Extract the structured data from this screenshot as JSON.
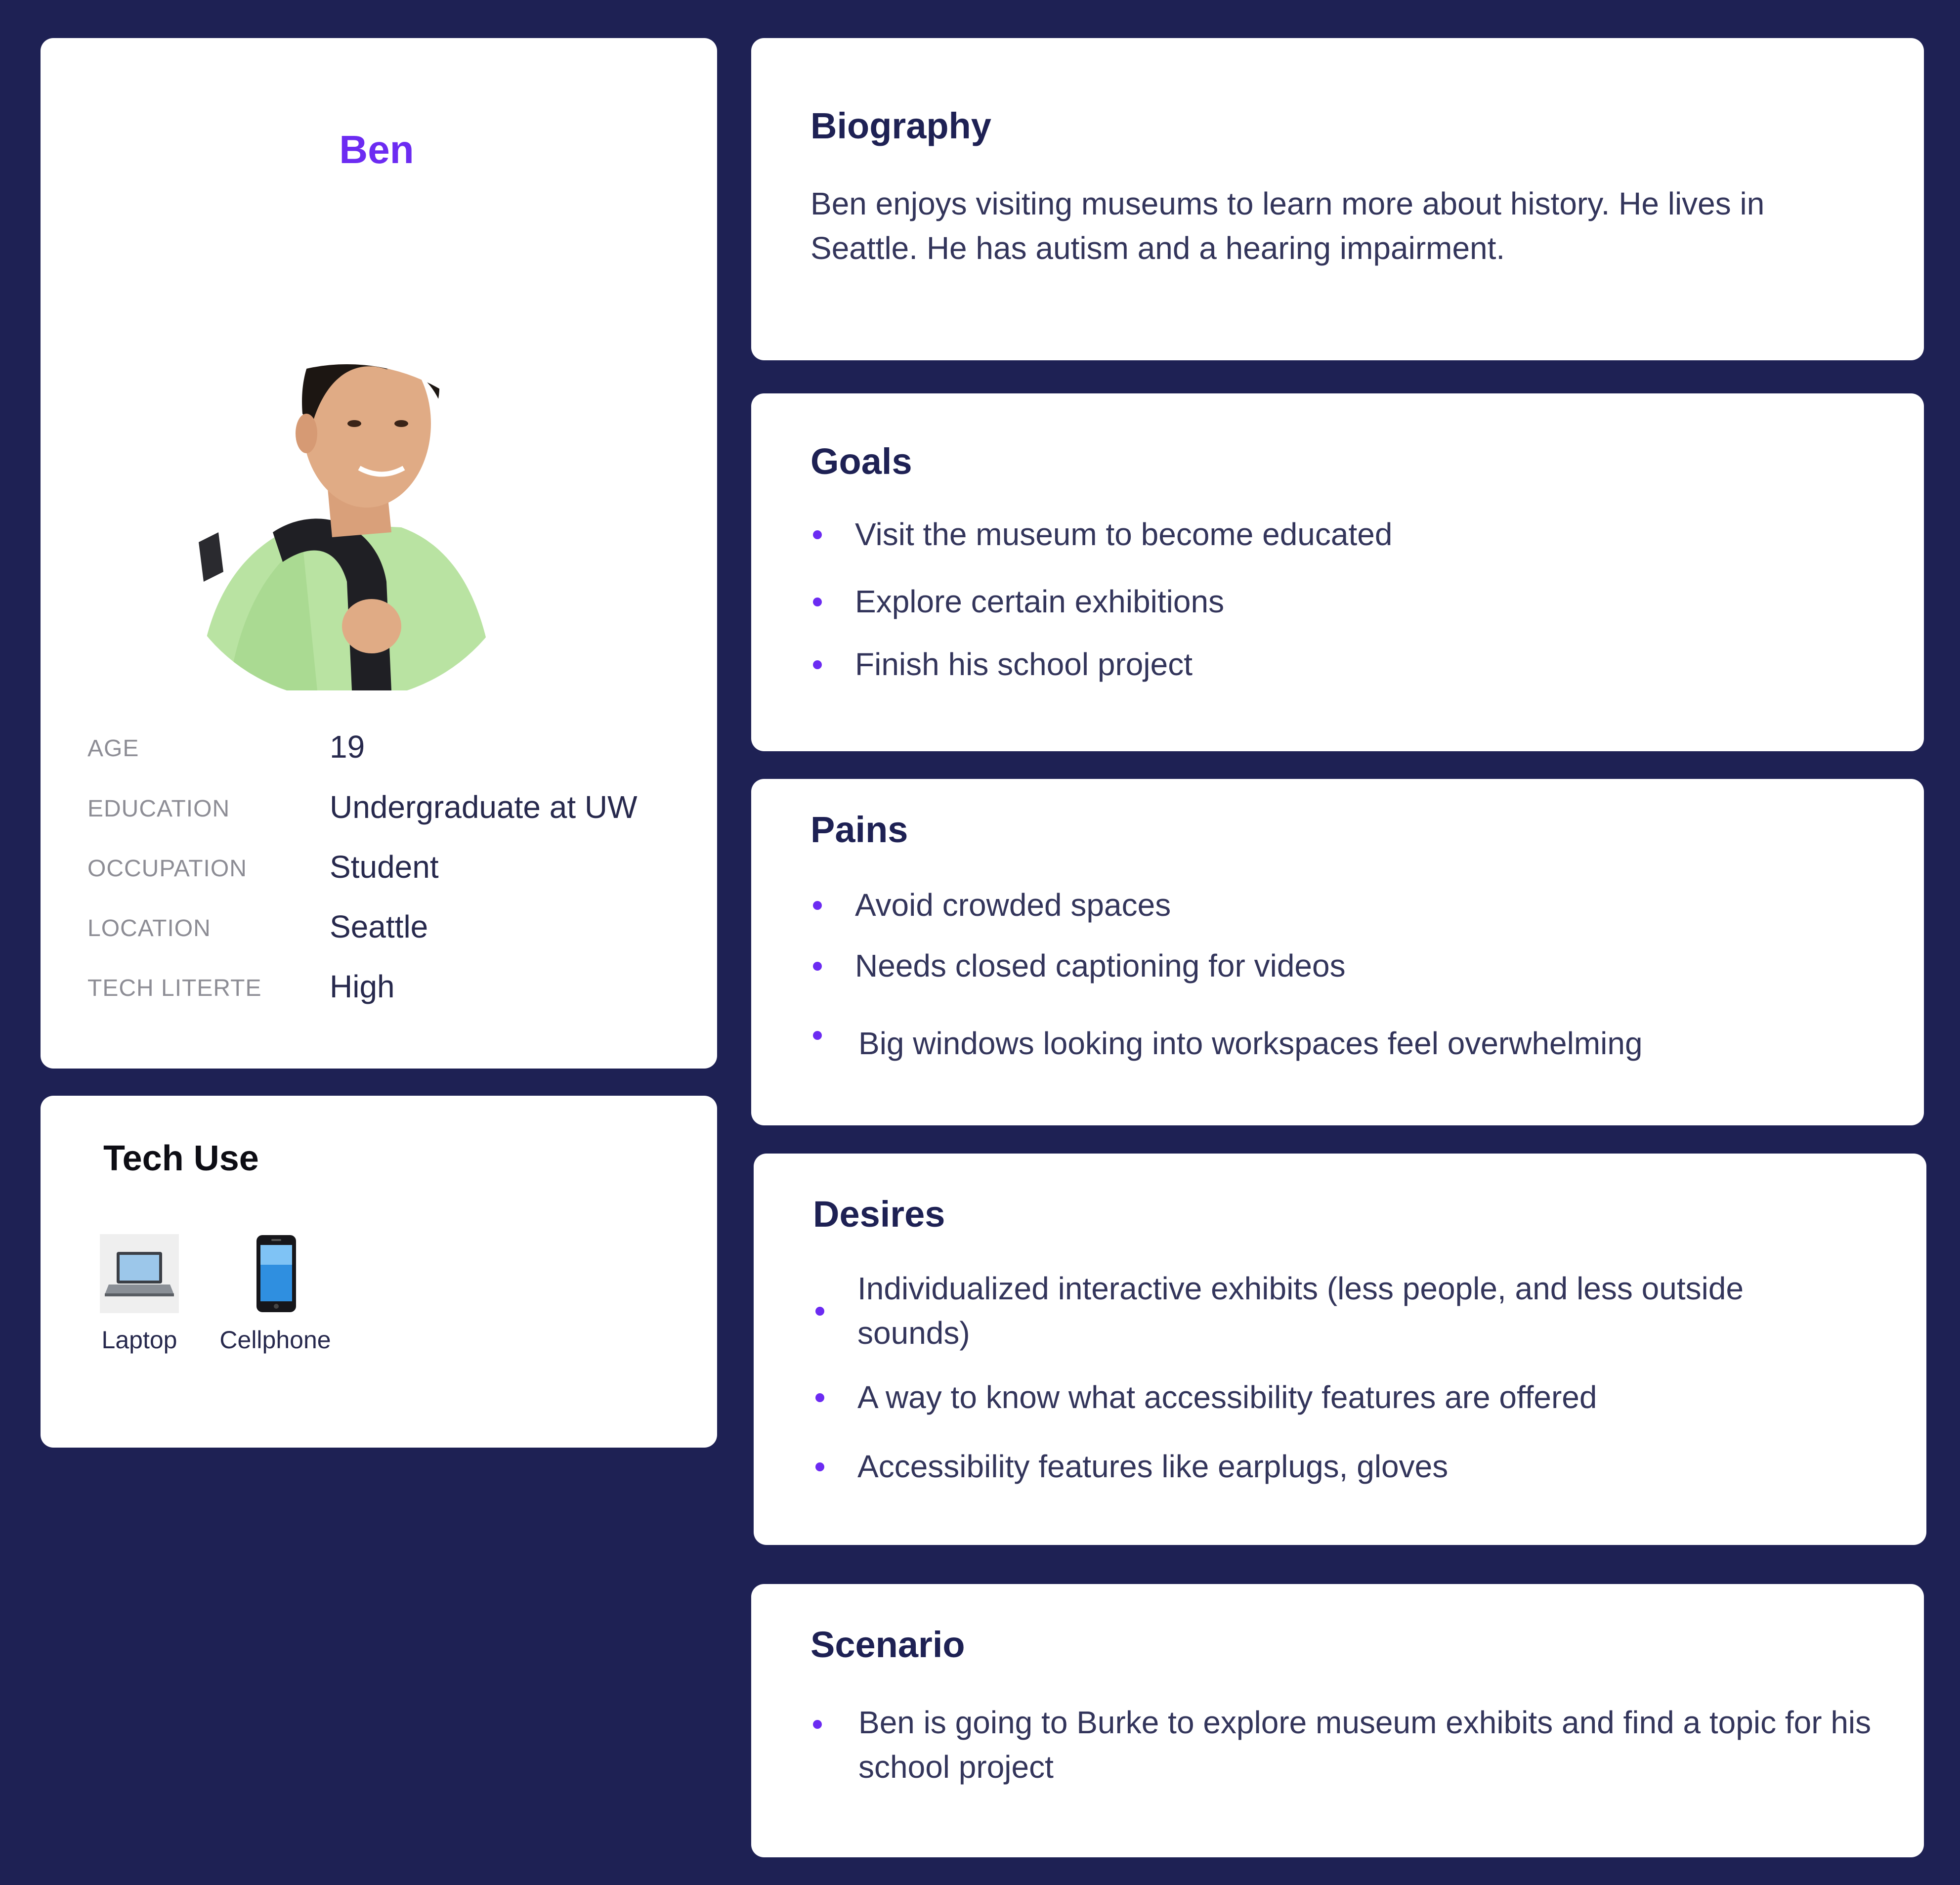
{
  "profile": {
    "name": "Ben",
    "attributes": [
      {
        "label": "AGE",
        "value": "19"
      },
      {
        "label": "EDUCATION",
        "value": "Undergraduate at UW"
      },
      {
        "label": "OCCUPATION",
        "value": "Student"
      },
      {
        "label": "LOCATION",
        "value": "Seattle"
      },
      {
        "label": "TECH LITERTE",
        "value": "High"
      }
    ]
  },
  "tech_use": {
    "title": "Tech Use",
    "devices": [
      {
        "label": "Laptop",
        "icon": "laptop-icon"
      },
      {
        "label": "Cellphone",
        "icon": "cellphone-icon"
      }
    ]
  },
  "biography": {
    "title": "Biography",
    "text": "Ben enjoys visiting museums to learn  more about history. He lives in Seattle. He has autism and a hearing impairment."
  },
  "goals": {
    "title": "Goals",
    "items": [
      "Visit the museum to become educated",
      "Explore certain exhibitions",
      "Finish his school project"
    ]
  },
  "pains": {
    "title": "Pains",
    "items": [
      "Avoid crowded spaces",
      "Needs closed captioning for videos",
      "Big windows looking into workspaces feel overwhelming"
    ]
  },
  "desires": {
    "title": "Desires",
    "items": [
      "Individualized interactive exhibits (less people, and less outside sounds)",
      "A way to know what accessibility features are offered",
      "Accessibility features like earplugs, gloves"
    ]
  },
  "scenario": {
    "title": "Scenario",
    "items": [
      "Ben is going to Burke to explore museum exhibits and find a topic for his school project"
    ]
  },
  "colors": {
    "background": "#1e2154",
    "accent": "#6c2bf2",
    "card": "#ffffff",
    "heading": "#1e2154"
  }
}
